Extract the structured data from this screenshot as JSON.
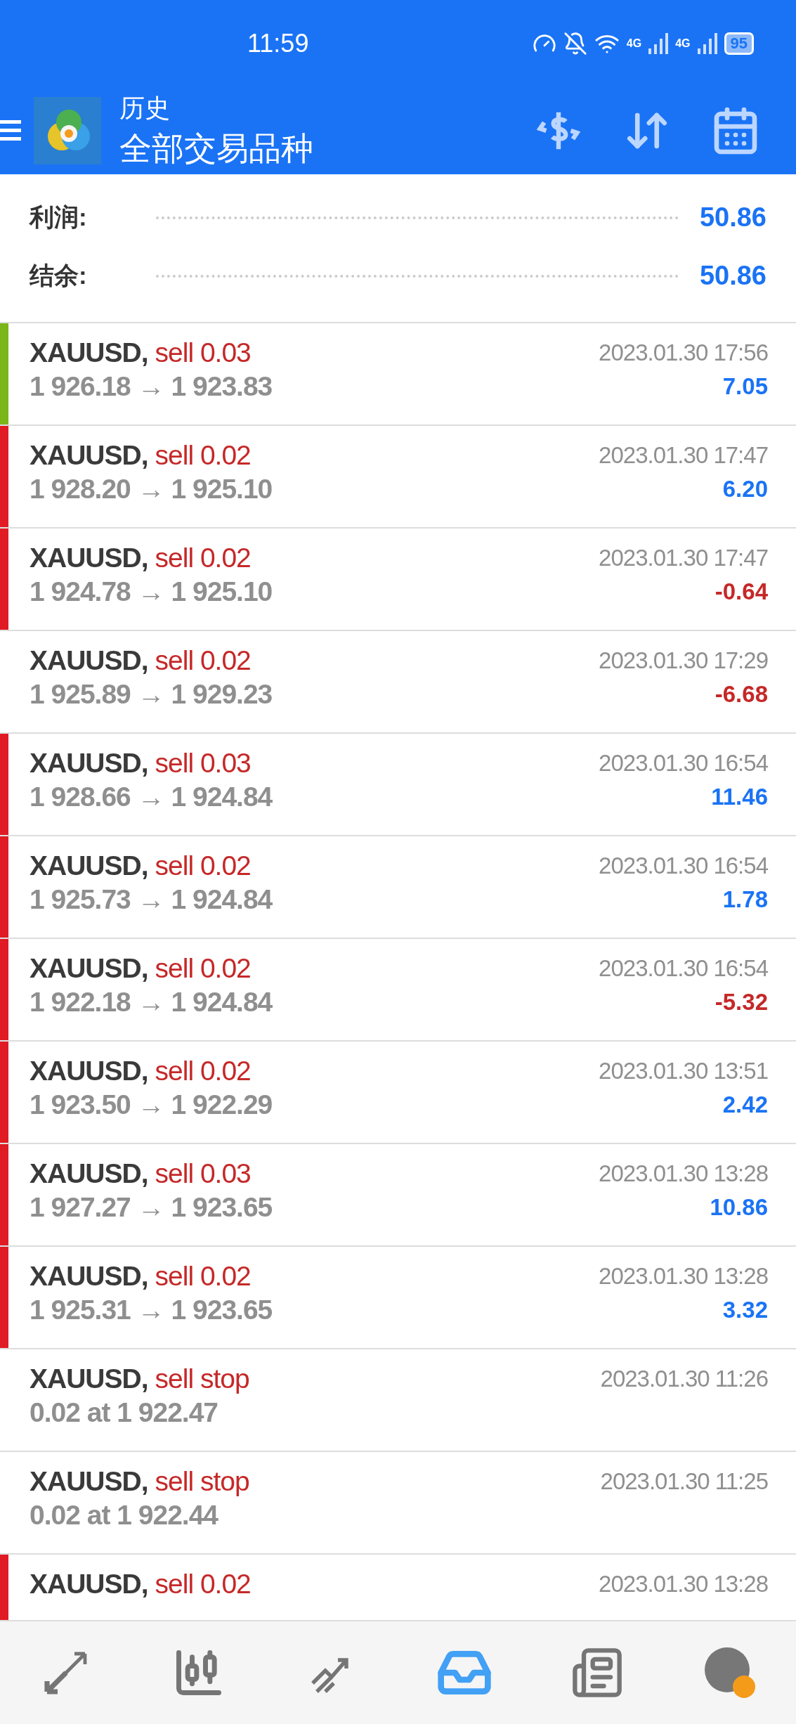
{
  "status_bar": {
    "time": "11:59",
    "networks": [
      "4G",
      "4G"
    ],
    "battery": "95"
  },
  "header": {
    "title": "历史",
    "subtitle": "全部交易品种"
  },
  "summary": [
    {
      "label": "利润:",
      "value": "50.86"
    },
    {
      "label": "结余:",
      "value": "50.86"
    }
  ],
  "deals": [
    {
      "symbol": "XAUUSD,",
      "side": "sell 0.03",
      "prices": "1 926.18 → 1 923.83",
      "time": "2023.01.30 17:56",
      "profit": "7.05",
      "loss": false,
      "color": "#7cb518"
    },
    {
      "symbol": "XAUUSD,",
      "side": "sell 0.02",
      "prices": "1 928.20 → 1 925.10",
      "time": "2023.01.30 17:47",
      "profit": "6.20",
      "loss": false,
      "color": "#e01b24"
    },
    {
      "symbol": "XAUUSD,",
      "side": "sell 0.02",
      "prices": "1 924.78 → 1 925.10",
      "time": "2023.01.30 17:47",
      "profit": "-0.64",
      "loss": true,
      "color": "#e01b24"
    },
    {
      "symbol": "XAUUSD,",
      "side": "sell 0.02",
      "prices": "1 925.89 → 1 929.23",
      "time": "2023.01.30 17:29",
      "profit": "-6.68",
      "loss": true
    },
    {
      "symbol": "XAUUSD,",
      "side": "sell 0.03",
      "prices": "1 928.66 → 1 924.84",
      "time": "2023.01.30 16:54",
      "profit": "11.46",
      "loss": false,
      "color": "#e01b24"
    },
    {
      "symbol": "XAUUSD,",
      "side": "sell 0.02",
      "prices": "1 925.73 → 1 924.84",
      "time": "2023.01.30 16:54",
      "profit": "1.78",
      "loss": false,
      "color": "#e01b24"
    },
    {
      "symbol": "XAUUSD,",
      "side": "sell 0.02",
      "prices": "1 922.18 → 1 924.84",
      "time": "2023.01.30 16:54",
      "profit": "-5.32",
      "loss": true,
      "color": "#e01b24"
    },
    {
      "symbol": "XAUUSD,",
      "side": "sell 0.02",
      "prices": "1 923.50 → 1 922.29",
      "time": "2023.01.30 13:51",
      "profit": "2.42",
      "loss": false,
      "color": "#e01b24"
    },
    {
      "symbol": "XAUUSD,",
      "side": "sell 0.03",
      "prices": "1 927.27 → 1 923.65",
      "time": "2023.01.30 13:28",
      "profit": "10.86",
      "loss": false,
      "color": "#e01b24"
    },
    {
      "symbol": "XAUUSD,",
      "side": "sell 0.02",
      "prices": "1 925.31 → 1 923.65",
      "time": "2023.01.30 13:28",
      "profit": "3.32",
      "loss": false,
      "color": "#e01b24"
    },
    {
      "symbol": "XAUUSD,",
      "side": "sell stop",
      "prices": "0.02 at 1 922.47",
      "time": "2023.01.30 11:26"
    },
    {
      "symbol": "XAUUSD,",
      "side": "sell stop",
      "prices": "0.02 at 1 922.44",
      "time": "2023.01.30 11:25"
    },
    {
      "symbol": "XAUUSD,",
      "side": "sell 0.02",
      "time": "2023.01.30 13:28",
      "color": "#e01b24"
    }
  ],
  "nav": [
    {
      "kind": "trade",
      "selected": false
    },
    {
      "kind": "quotes",
      "selected": false
    },
    {
      "kind": "chart",
      "selected": false
    },
    {
      "kind": "history",
      "selected": true
    },
    {
      "kind": "news",
      "selected": false
    },
    {
      "kind": "profile",
      "selected": false
    }
  ]
}
